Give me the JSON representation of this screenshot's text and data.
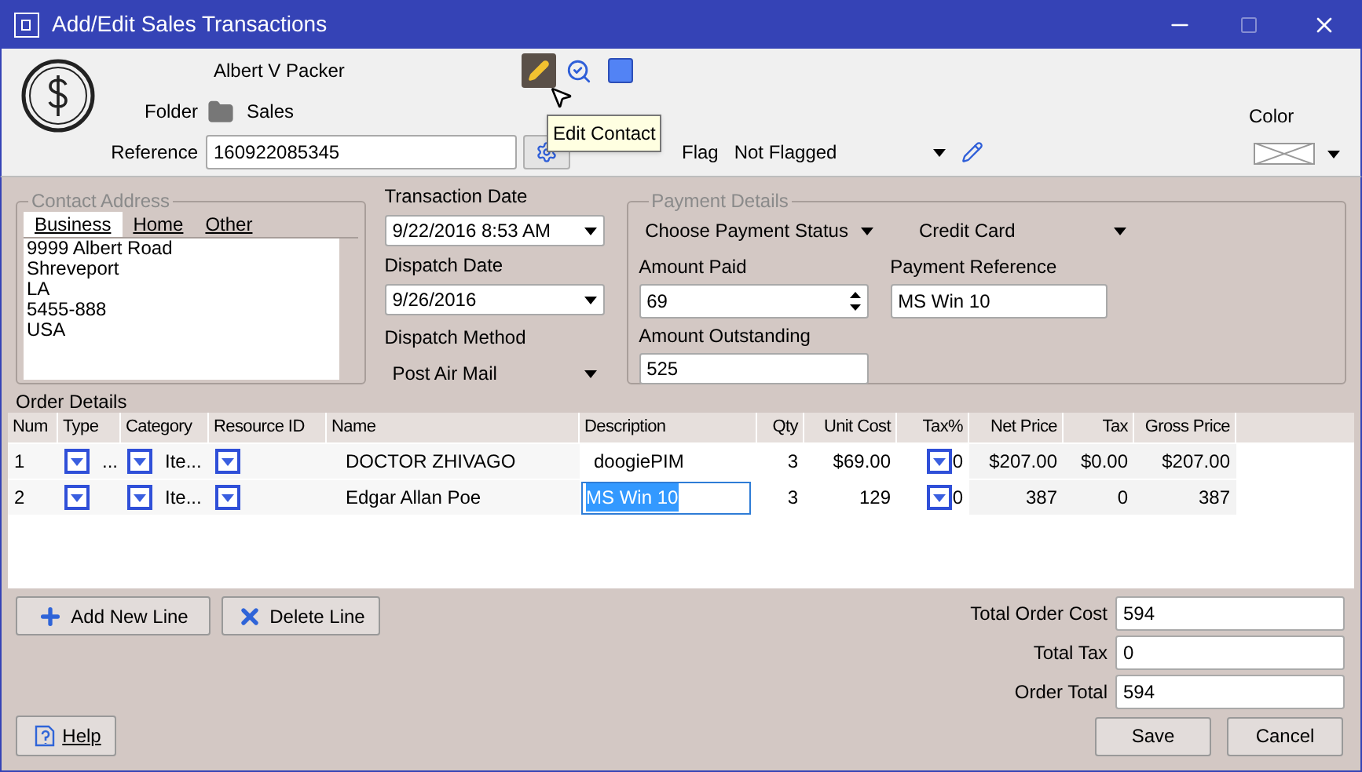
{
  "window": {
    "title": "Add/Edit Sales Transactions"
  },
  "header": {
    "contact_name": "Albert V Packer",
    "folder_label": "Folder",
    "folder": "Sales",
    "reference_label": "Reference",
    "reference": "160922085345",
    "flag_label": "Flag",
    "flag": "Not Flagged",
    "color_label": "Color",
    "tooltip": "Edit Contact"
  },
  "contact_address": {
    "title": "Contact Address",
    "tabs": [
      {
        "label": "Business",
        "selected": true
      },
      {
        "label": "Home",
        "selected": false
      },
      {
        "label": "Other",
        "selected": false
      }
    ],
    "lines": [
      "9999 Albert Road",
      "Shreveport",
      "LA",
      "5455-888",
      "USA"
    ]
  },
  "dates": {
    "transaction_label": "Transaction Date",
    "transaction": "9/22/2016 8:53 AM",
    "dispatch_label": "Dispatch Date",
    "dispatch": "9/26/2016",
    "method_label": "Dispatch Method",
    "method": "Post Air Mail"
  },
  "payment": {
    "title": "Payment Details",
    "status": "Choose Payment Status",
    "type": "Credit Card",
    "amount_paid_label": "Amount Paid",
    "amount_paid": "69",
    "reference_label": "Payment Reference",
    "reference": "MS Win 10",
    "outstanding_label": "Amount Outstanding",
    "outstanding": "525"
  },
  "order": {
    "title": "Order Details",
    "columns": [
      "Num",
      "Type",
      "Category",
      "Resource ID",
      "Name",
      "Description",
      "Qty",
      "Unit Cost",
      "Tax%",
      "Net Price",
      "Tax",
      "Gross Price"
    ],
    "rows": [
      {
        "num": "1",
        "type": "...",
        "category": "Ite...",
        "name": "DOCTOR ZHIVAGO",
        "description": "doogiePIM",
        "editing": false,
        "qty": "3",
        "unit_cost": "$69.00",
        "tax_pct": "0",
        "net_price": "$207.00",
        "tax": "$0.00",
        "gross_price": "$207.00"
      },
      {
        "num": "2",
        "category": "Ite...",
        "name": "Edgar Allan Poe",
        "description": "MS Win 10",
        "editing": true,
        "qty": "3",
        "unit_cost": "129",
        "tax_pct": "0",
        "net_price": "387",
        "tax": "0",
        "gross_price": "387"
      }
    ]
  },
  "line_buttons": [
    "Add New Line",
    "Delete Line"
  ],
  "totals": [
    {
      "label": "Total Order Cost",
      "value": "594"
    },
    {
      "label": "Total Tax",
      "value": "0"
    },
    {
      "label": "Order Total",
      "value": "594"
    }
  ],
  "buttons": {
    "help": "Help",
    "save": "Save",
    "cancel": "Cancel"
  }
}
